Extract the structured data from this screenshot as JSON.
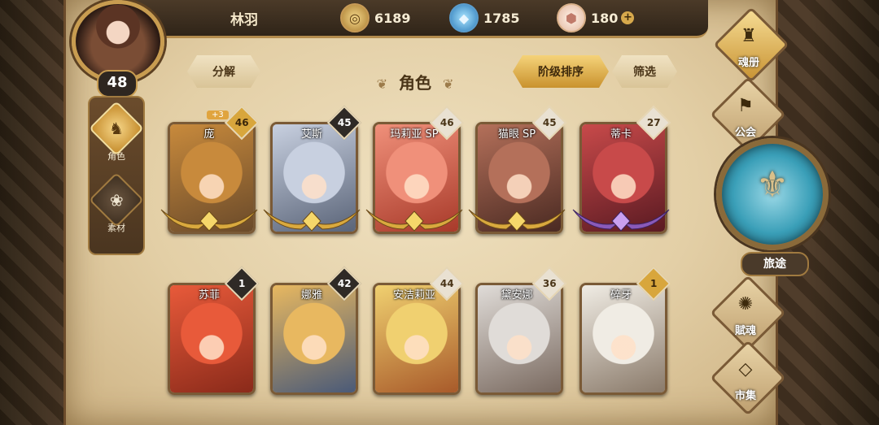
{
  "player": {
    "name": "林羽",
    "level": "48"
  },
  "resources": [
    {
      "icon": "coin-icon",
      "glyph": "◎",
      "value": "6189"
    },
    {
      "icon": "crystal-icon",
      "glyph": "◆",
      "value": "1785"
    },
    {
      "icon": "gem-icon",
      "glyph": "⬢",
      "value": "180"
    }
  ],
  "plus_label": "+",
  "left_nav": [
    {
      "label": "角色",
      "glyph": "♞",
      "active": true
    },
    {
      "label": "素材",
      "glyph": "❀",
      "active": false
    }
  ],
  "toolbar": {
    "decompose": "分解",
    "title": "角色",
    "sort": "阶级排序",
    "filter": "筛选"
  },
  "cards": [
    {
      "name": "庞",
      "level": "46",
      "badge": "gold",
      "bonus": "+3",
      "wings": "gold",
      "colors": [
        "#c88a3c",
        "#6a4a2a"
      ]
    },
    {
      "name": "艾斯",
      "level": "45",
      "badge": "dark",
      "bonus": "",
      "wings": "gold",
      "colors": [
        "#c8d0e0",
        "#5a6478"
      ]
    },
    {
      "name": "玛莉亚 SP",
      "level": "46",
      "badge": "light",
      "bonus": "",
      "wings": "gold",
      "colors": [
        "#f0907a",
        "#a83a2a"
      ]
    },
    {
      "name": "猫眼 SP",
      "level": "45",
      "badge": "light",
      "bonus": "",
      "wings": "gold",
      "colors": [
        "#b4705a",
        "#4a2a22"
      ]
    },
    {
      "name": "蒂卡",
      "level": "27",
      "badge": "light",
      "bonus": "",
      "wings": "purple",
      "colors": [
        "#c84a4a",
        "#5a1a22"
      ]
    },
    {
      "name": "苏菲",
      "level": "1",
      "badge": "dark",
      "bonus": "",
      "wings": "none",
      "colors": [
        "#e85a3a",
        "#8a2a1a"
      ]
    },
    {
      "name": "娜雅",
      "level": "42",
      "badge": "dark",
      "bonus": "",
      "wings": "none",
      "colors": [
        "#e8b860",
        "#4a5a78"
      ]
    },
    {
      "name": "安洁莉亚",
      "level": "44",
      "badge": "light",
      "bonus": "",
      "wings": "none",
      "colors": [
        "#f0d070",
        "#a85a2a"
      ]
    },
    {
      "name": "黛安娜",
      "level": "36",
      "badge": "light",
      "bonus": "",
      "wings": "none",
      "colors": [
        "#e0dcd8",
        "#7a6a60"
      ]
    },
    {
      "name": "碎牙",
      "level": "1",
      "badge": "gold",
      "bonus": "",
      "wings": "none",
      "colors": [
        "#f0ece4",
        "#8a7a6a"
      ]
    }
  ],
  "right_nav": {
    "soul_book": "魂册",
    "guild": "公会",
    "travel": "旅途",
    "soul_gift": "賦魂",
    "market": "市集"
  }
}
